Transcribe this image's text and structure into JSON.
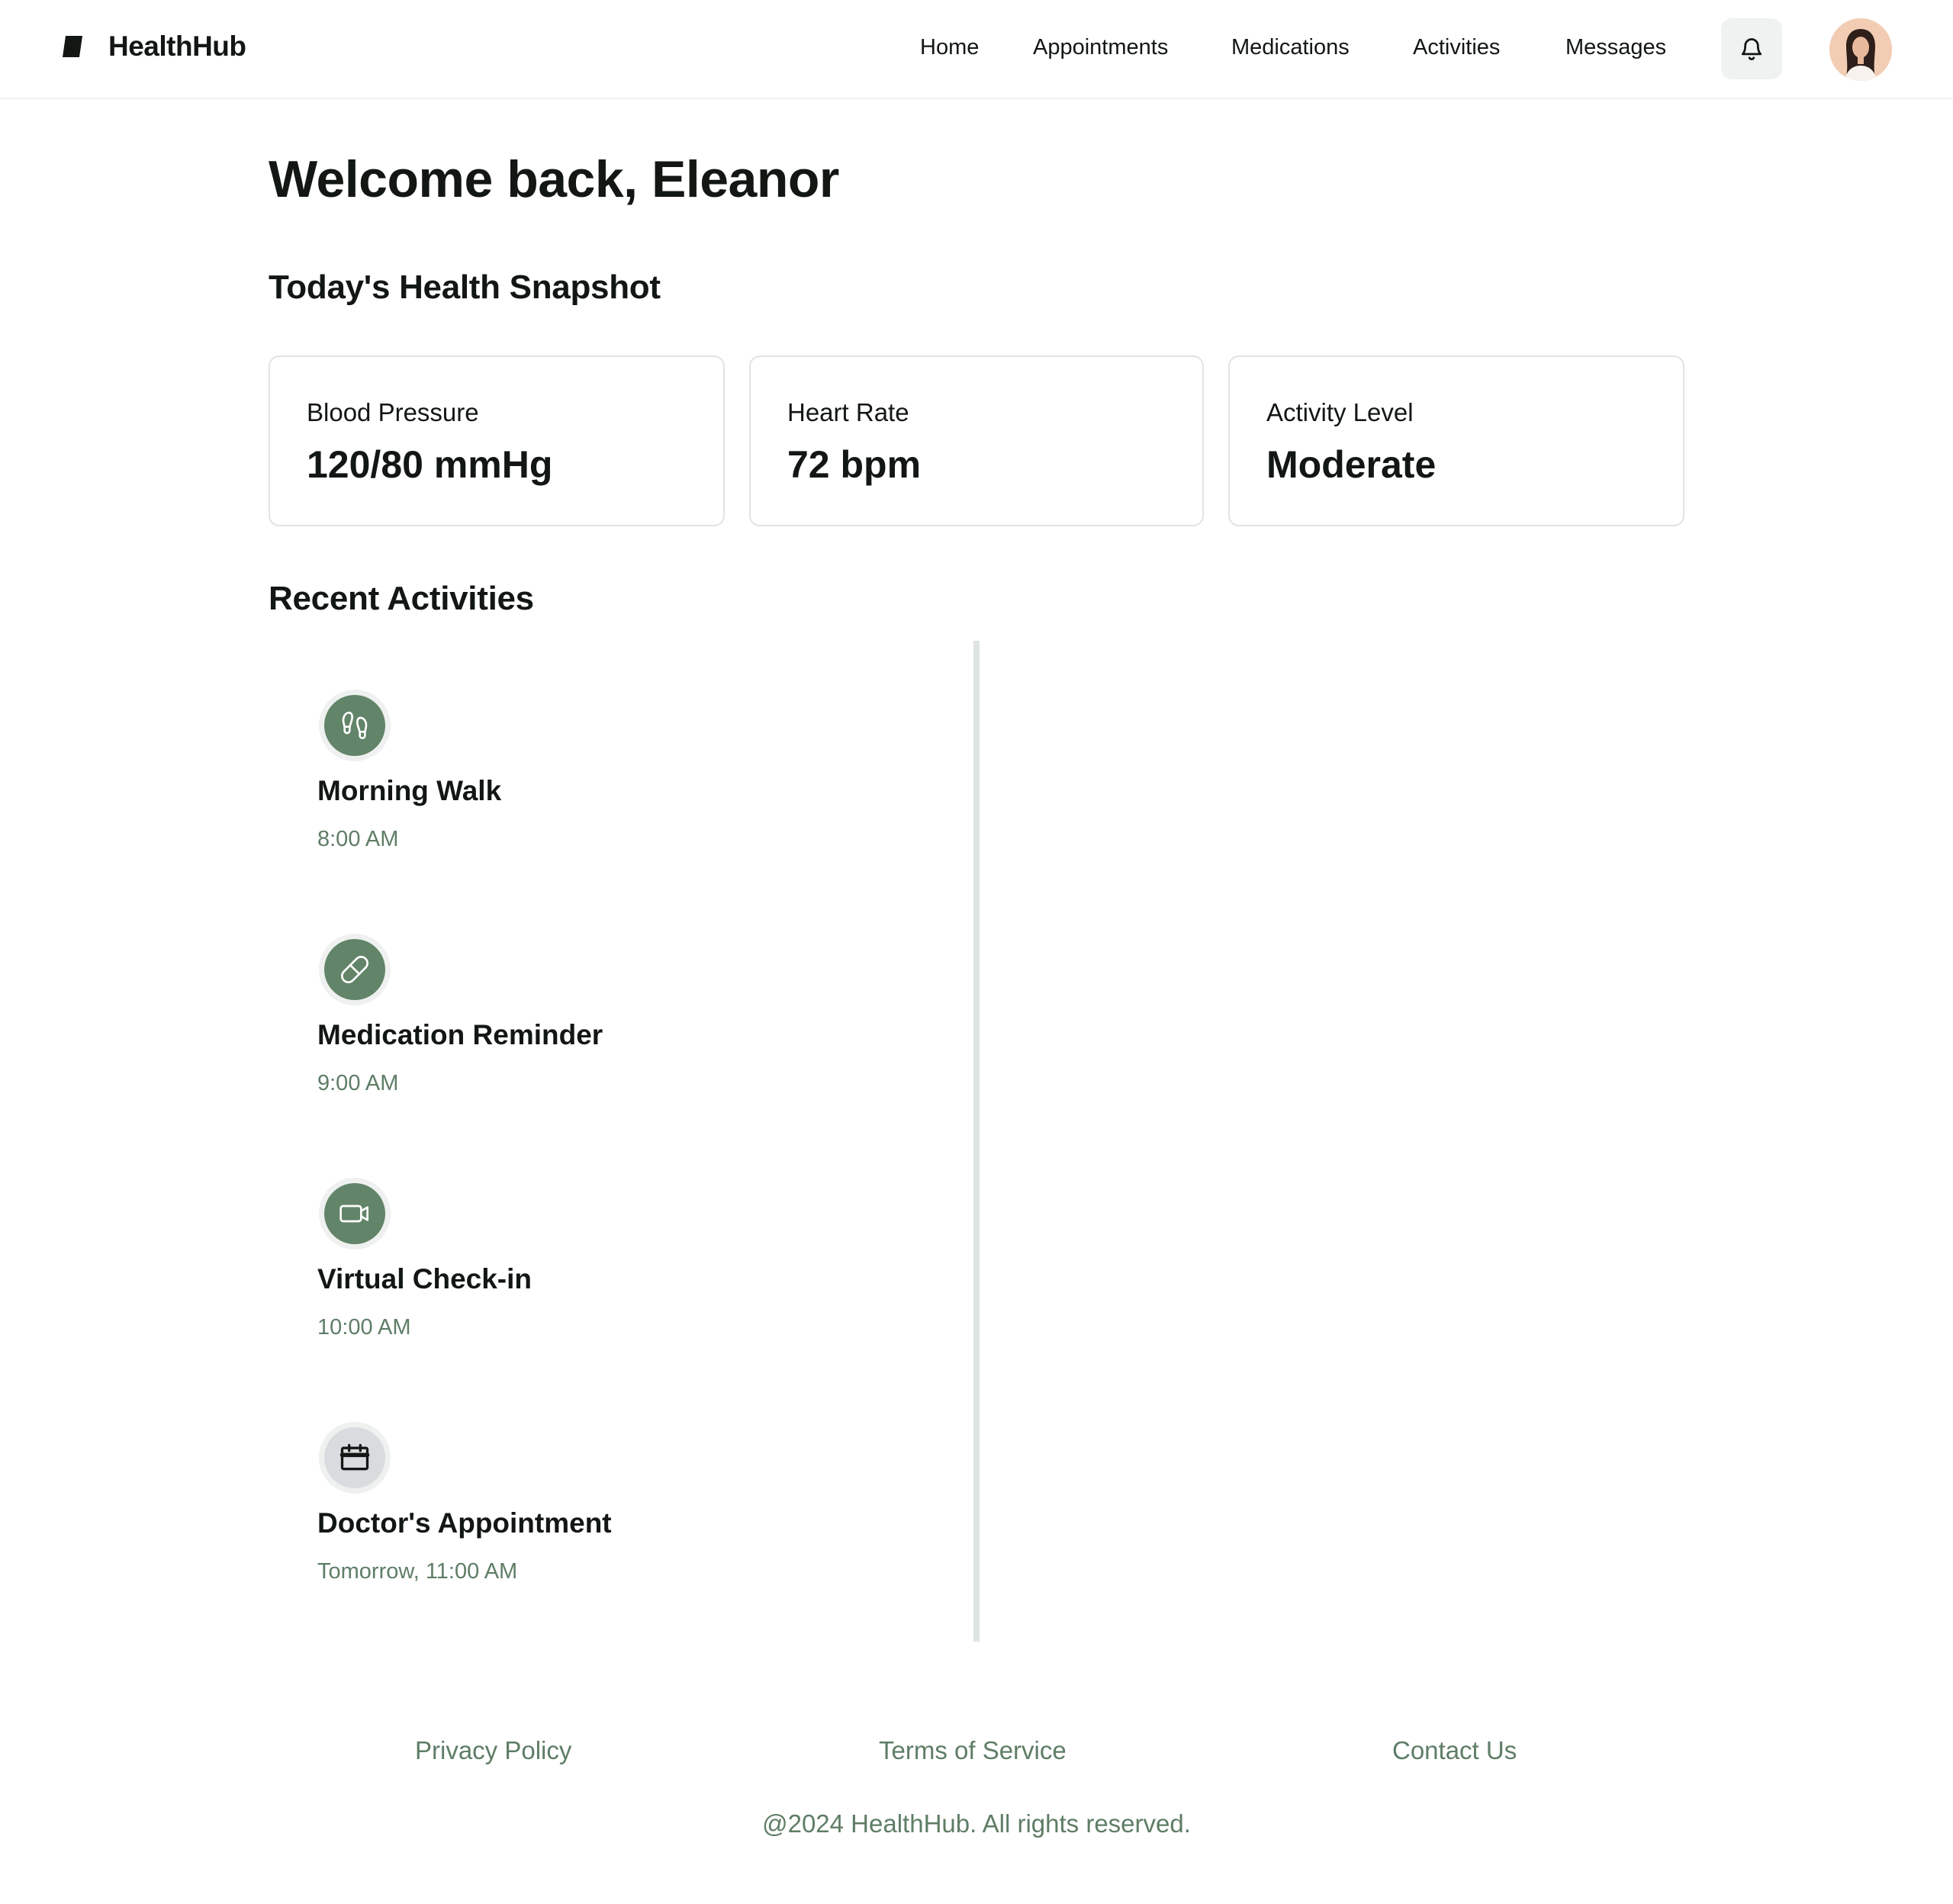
{
  "app": {
    "name": "HealthHub",
    "logo_icon": "bookmark-tag-icon"
  },
  "nav": {
    "items": [
      {
        "label": "Home"
      },
      {
        "label": "Appointments"
      },
      {
        "label": "Medications"
      },
      {
        "label": "Activities"
      },
      {
        "label": "Messages"
      }
    ],
    "notification_icon": "bell-icon",
    "avatar_icon": "user-avatar"
  },
  "main": {
    "welcome": "Welcome back, Eleanor",
    "snapshot_title": "Today's Health Snapshot",
    "snapshot": [
      {
        "label": "Blood Pressure",
        "value": "120/80 mmHg"
      },
      {
        "label": "Heart Rate",
        "value": "72 bpm"
      },
      {
        "label": "Activity Level",
        "value": "Moderate"
      }
    ],
    "activities_title": "Recent Activities",
    "activities": [
      {
        "title": "Morning Walk",
        "time": "8:00 AM",
        "icon": "footprints-icon"
      },
      {
        "title": "Medication Reminder",
        "time": "9:00 AM",
        "icon": "pill-icon"
      },
      {
        "title": "Virtual Check-in",
        "time": "10:00 AM",
        "icon": "video-camera-icon"
      },
      {
        "title": "Doctor's Appointment",
        "time": "Tomorrow, 11:00 AM",
        "icon": "calendar-icon"
      }
    ]
  },
  "footer": {
    "links": [
      {
        "label": "Privacy Policy"
      },
      {
        "label": "Terms of Service"
      },
      {
        "label": "Contact Us"
      }
    ],
    "copyright": "@2024 HealthHub. All rights reserved."
  },
  "colors": {
    "accent": "#628468",
    "muted_text": "#5f7d66",
    "border": "#dfe4e1",
    "text": "#121714"
  }
}
